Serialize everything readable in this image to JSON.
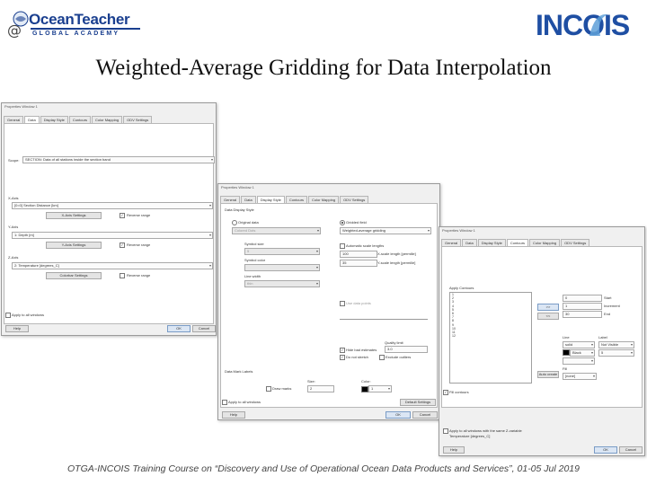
{
  "header": {
    "logo_left_main": "OceanTeacher",
    "logo_left_sub": "GLOBAL ACADEMY",
    "logo_left_at": "@",
    "logo_right": "INCOIS"
  },
  "slide_title": "Weighted-Average Gridding for Data Interpolation",
  "footer": "OTGA-INCOIS Training Course on “Discovery and Use of Operational Ocean Data Products and Services”, 01-05 Jul 2019",
  "win1": {
    "title": "Properties Window 1",
    "tabs": [
      "General",
      "Data",
      "Display Style",
      "Contours",
      "Color Mapping",
      "ODV Settings"
    ],
    "scope_label": "Scope:",
    "scope_value": "SECTION: Data of all stations inside the section band",
    "xaxis_label": "X-Axis",
    "xaxis_value": "[0=0] Section Distance [km]",
    "xaxis_btn": "X-Axis Settings",
    "yaxis_label": "Y-Axis",
    "yaxis_value": "1: Depth [m]",
    "yaxis_btn": "Y-Axis Settings",
    "zaxis_label": "Z-Axis",
    "zaxis_value": "2: Temperature [degrees_C]",
    "zaxis_btn": "Colorbar Settings",
    "reverse_label": "Reverse range",
    "apply_all": "Apply to all windows",
    "help_btn": "Help",
    "ok_btn": "OK",
    "cancel_btn": "Cancel"
  },
  "win2": {
    "title": "Properties Window 1",
    "tabs": [
      "General",
      "Data",
      "Display Style",
      "Contours",
      "Color Mapping",
      "ODV Settings"
    ],
    "data_display_style": "Data Display Style",
    "original_data": "Original data",
    "gridded_field": "Gridded field",
    "colored_dots": "Colored Dots",
    "gridding_method": "Weighted-average gridding",
    "symbol_size": "Symbol size",
    "symbol_size_value": "5",
    "symbol_color": "Symbol color",
    "line_width": "Line width",
    "line_width_value": "thin",
    "auto_scale": "Automatic scale lengths",
    "x_scale_value": "100",
    "x_scale_label": "X-scale length [permille]",
    "y_scale_value": "35",
    "y_scale_label": "Y-scale length [permille]",
    "tolerance_label": "Use data points",
    "quality_limit": "Quality limit",
    "quality_value": "3.0",
    "hide_bad": "Hide bad estimates",
    "do_not_stretch": "Do not stretch",
    "exclude_outliers": "Exclude outliers",
    "data_mark_labels": "Data Mark Labels",
    "size_label": "Size:",
    "color_label": "Color:",
    "size_value": "2",
    "color_value": "1",
    "draw_marks": "Draw marks",
    "apply_all": "Apply to all windows",
    "default_btn": "Default Settings",
    "help_btn": "Help",
    "ok_btn": "OK",
    "cancel_btn": "Cancel"
  },
  "win3": {
    "title": "Properties Window 1",
    "tabs": [
      "General",
      "Data",
      "Display Style",
      "Contours",
      "Color Mapping",
      "ODV Settings"
    ],
    "apply_contours": "Apply Contours",
    "contour_values": [
      "1",
      "2",
      "3",
      "4",
      "5",
      "6",
      "7",
      "8",
      "9",
      "10",
      "11",
      "12"
    ],
    "add_btn": ">>",
    "remove_btn": "<<",
    "start_label": "Start",
    "start_value": "0",
    "increment_label": "Increment",
    "increment_value": "1",
    "end_label": "End",
    "end_value": "30",
    "line_label": "Line",
    "label_label": "Label",
    "line_style": "solid",
    "label_style": "Not Visible",
    "line_color": "Black",
    "label_size": "5",
    "fill_label": "Fill",
    "fill_value": "[none]",
    "auto_create_btn": "Auto create",
    "show_contours": "Fill contours",
    "apply_all": "Apply to all windows with the same Z-variable",
    "z_var": "Temperature [degrees_C]",
    "help_btn": "Help",
    "ok_btn": "OK",
    "cancel_btn": "Cancel"
  }
}
